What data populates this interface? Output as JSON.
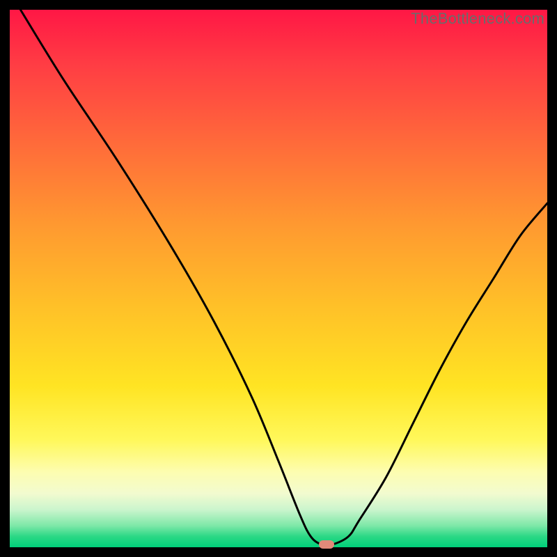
{
  "watermark": "TheBottleneck.com",
  "colors": {
    "frame": "#000000",
    "curve": "#000000",
    "marker": "#e18a7a",
    "gradient_top": "#ff1745",
    "gradient_bottom": "#00cf7a"
  },
  "chart_data": {
    "type": "line",
    "title": "",
    "xlabel": "",
    "ylabel": "",
    "xlim": [
      0,
      100
    ],
    "ylim": [
      0,
      100
    ],
    "grid": false,
    "series": [
      {
        "name": "bottleneck-curve",
        "x": [
          2,
          10,
          20,
          30,
          38,
          45,
          50,
          54,
          56,
          58,
          60,
          63,
          65,
          70,
          75,
          80,
          85,
          90,
          95,
          100
        ],
        "values": [
          100,
          87,
          72,
          56,
          42,
          28,
          16,
          6,
          2,
          0.5,
          0.5,
          2,
          5,
          13,
          23,
          33,
          42,
          50,
          58,
          64
        ]
      }
    ],
    "annotations": [
      {
        "name": "optimal-marker",
        "x": 59,
        "y": 0.5
      }
    ]
  }
}
